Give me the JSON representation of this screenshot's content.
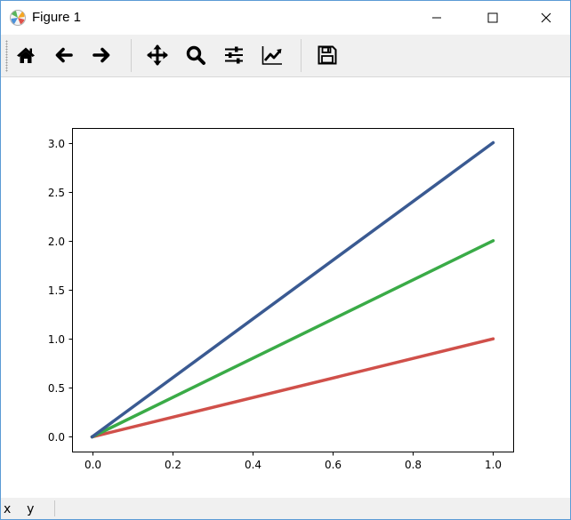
{
  "window": {
    "title": "Figure 1"
  },
  "toolbar": {
    "buttons": [
      {
        "name": "home",
        "icon": "home-icon"
      },
      {
        "name": "back",
        "icon": "arrow-left-icon"
      },
      {
        "name": "forward",
        "icon": "arrow-right-icon"
      },
      {
        "name": "pan",
        "icon": "move-icon"
      },
      {
        "name": "zoom",
        "icon": "magnifier-icon"
      },
      {
        "name": "subplots",
        "icon": "sliders-icon"
      },
      {
        "name": "customize",
        "icon": "line-chart-icon"
      },
      {
        "name": "save",
        "icon": "floppy-disk-icon"
      }
    ]
  },
  "status": {
    "coords": "x    y"
  },
  "chart_data": {
    "type": "line",
    "title": "",
    "xlabel": "",
    "ylabel": "",
    "xlim": [
      -0.05,
      1.05
    ],
    "ylim": [
      -0.15,
      3.15
    ],
    "xticks": [
      "0.0",
      "0.2",
      "0.4",
      "0.6",
      "0.8",
      "1.0"
    ],
    "yticks": [
      "0.0",
      "0.5",
      "1.0",
      "1.5",
      "2.0",
      "2.5",
      "3.0"
    ],
    "grid": false,
    "series": [
      {
        "x": [
          0,
          1
        ],
        "values": [
          0,
          1
        ],
        "color": "#d0504a"
      },
      {
        "x": [
          0,
          1
        ],
        "values": [
          0,
          2
        ],
        "color": "#3aab47"
      },
      {
        "x": [
          0,
          1
        ],
        "values": [
          0,
          3
        ],
        "color": "#3a5a92"
      }
    ]
  }
}
